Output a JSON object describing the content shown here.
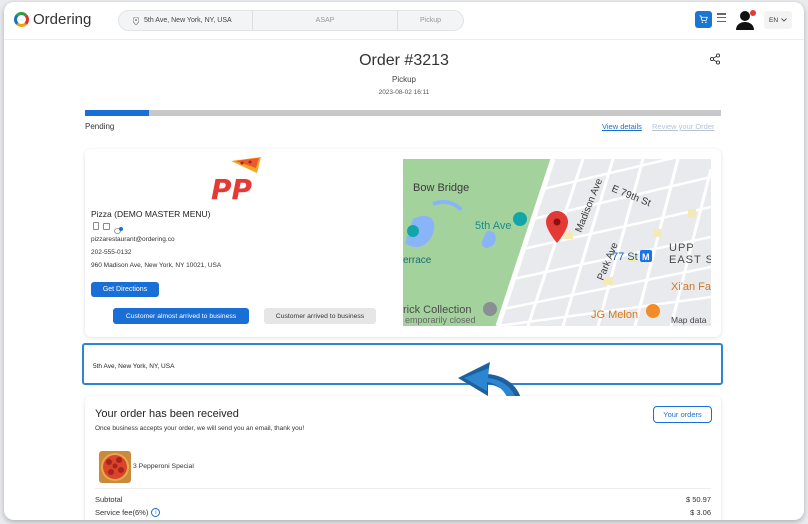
{
  "header": {
    "brand": "Ordering",
    "search": {
      "address": "5th Ave, New York, NY, USA",
      "time": "ASAP",
      "mode": "Pickup"
    },
    "language": "EN"
  },
  "order": {
    "title": "Order #3213",
    "delivery_type": "Pickup",
    "date": "2023-08-02 16:11",
    "status": "Pending",
    "progress": 0.1,
    "view_details": "View details",
    "review_order": "Review your Order"
  },
  "business": {
    "logo_text": "PP",
    "name": "Pizza (DEMO MASTER MENU)",
    "email": "pizzarestaurant@ordering.co",
    "phone": "202-555-0132",
    "address": "960 Madison Ave, New York, NY 10021, USA",
    "get_directions": "Get Directions",
    "almost_arrived": "Customer almost arrived to business",
    "arrived": "Customer arrived to business"
  },
  "map": {
    "labels": [
      "Bow Bridge",
      "5th Ave",
      "Madison Ave",
      "E 79th St",
      "77 St",
      "M",
      "UPP",
      "EAST S",
      "errace",
      "Park Ave",
      "Xi'an Fa",
      "rick Collection",
      "emporarily closed",
      "JG Melon",
      "Map data"
    ]
  },
  "customer_address": "5th Ave, New York, NY, USA",
  "received": {
    "title": "Your order has been received",
    "subtitle": "Once business accepts your order, we will send you an email, thank you!",
    "your_orders": "Your orders",
    "product": "3 Pepperoni Special",
    "subtotal_label": "Subtotal",
    "subtotal_value": "$ 50.97",
    "service_fee_label": "Service fee(6%)",
    "service_fee_value": "$ 3.06",
    "info_glyph": "i"
  },
  "colors": {
    "primary": "#1a6fd6",
    "highlight": "#2d86d0",
    "pin": "#e53935"
  }
}
